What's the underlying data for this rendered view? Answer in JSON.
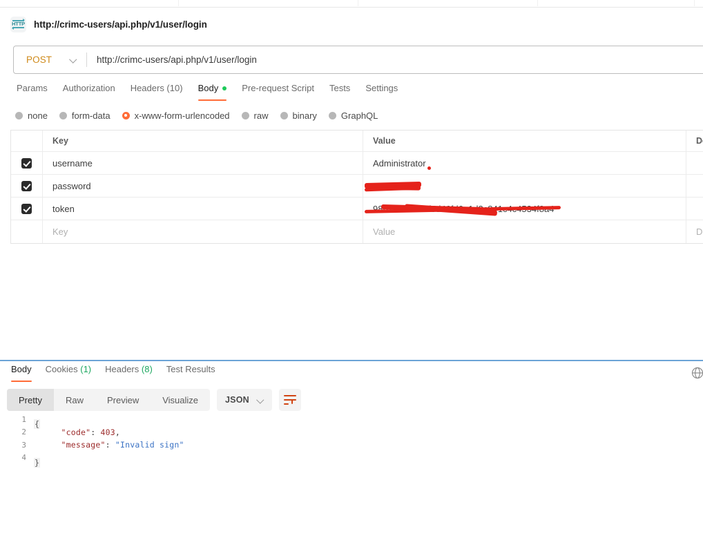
{
  "window": {
    "request_title": "http://crimc-users/api.php/v1/user/login",
    "title_icon": "http-badge-icon"
  },
  "url_bar": {
    "method": "POST",
    "method_chevron_icon": "chevron-down-icon",
    "url": "http://crimc-users/api.php/v1/user/login"
  },
  "request_tabs": [
    {
      "label": "Params",
      "active": false,
      "dot": false
    },
    {
      "label": "Authorization",
      "active": false,
      "dot": false
    },
    {
      "label": "Headers (10)",
      "active": false,
      "dot": false
    },
    {
      "label": "Body",
      "active": true,
      "dot": true
    },
    {
      "label": "Pre-request Script",
      "active": false,
      "dot": false
    },
    {
      "label": "Tests",
      "active": false,
      "dot": false
    },
    {
      "label": "Settings",
      "active": false,
      "dot": false
    }
  ],
  "body_types": [
    {
      "label": "none",
      "selected": false
    },
    {
      "label": "form-data",
      "selected": false
    },
    {
      "label": "x-www-form-urlencoded",
      "selected": true
    },
    {
      "label": "raw",
      "selected": false
    },
    {
      "label": "binary",
      "selected": false
    },
    {
      "label": "GraphQL",
      "selected": false
    }
  ],
  "params_table": {
    "headers": {
      "key": "Key",
      "value": "Value",
      "description": "De"
    },
    "rows": [
      {
        "checked": true,
        "key": "username",
        "value": "Administrator",
        "description": "",
        "redacted": false
      },
      {
        "checked": true,
        "key": "password",
        "value": "",
        "description": "",
        "redacted": true
      },
      {
        "checked": true,
        "key": "token",
        "value": "98b1a4f2-683f5d46fd6e1d3c841c4c4534f8a4",
        "description": "",
        "redacted": true
      }
    ],
    "new_row": {
      "key_placeholder": "Key",
      "value_placeholder": "Value",
      "description_placeholder": "De"
    }
  },
  "response_tabs": [
    {
      "label": "Body",
      "count": "",
      "active": true
    },
    {
      "label": "Cookies",
      "count": "(1)",
      "active": false
    },
    {
      "label": "Headers",
      "count": "(8)",
      "active": false
    },
    {
      "label": "Test Results",
      "count": "",
      "active": false
    }
  ],
  "response_toolbar": {
    "views": [
      {
        "label": "Pretty",
        "active": true
      },
      {
        "label": "Raw",
        "active": false
      },
      {
        "label": "Preview",
        "active": false
      },
      {
        "label": "Visualize",
        "active": false
      }
    ],
    "format": "JSON",
    "format_chevron_icon": "chevron-down-icon",
    "wrap_button_icon": "word-wrap-icon",
    "globe_icon": "globe-icon"
  },
  "response_body": {
    "line_numbers": [
      "1",
      "2",
      "3",
      "4"
    ],
    "lines": [
      {
        "fold": "{",
        "indent": "",
        "key": "",
        "punc": "",
        "num": "",
        "str": ""
      },
      {
        "fold": "",
        "indent": "    ",
        "key": "\"code\"",
        "punc": ": ",
        "num": "403",
        "tail": ","
      },
      {
        "fold": "",
        "indent": "    ",
        "key": "\"message\"",
        "punc": ": ",
        "str": "\"Invalid sign\""
      },
      {
        "fold": "}",
        "indent": "",
        "key": "",
        "punc": "",
        "num": "",
        "str": ""
      }
    ]
  },
  "colors": {
    "accent_orange": "#ff6c37",
    "method_post": "#cf8a1a",
    "green_dot": "#1ec95a",
    "redaction_red": "#e5231b",
    "json_key": "#9c2b2b",
    "json_string": "#3a72c4",
    "divider_blue": "#6ba3d6"
  }
}
